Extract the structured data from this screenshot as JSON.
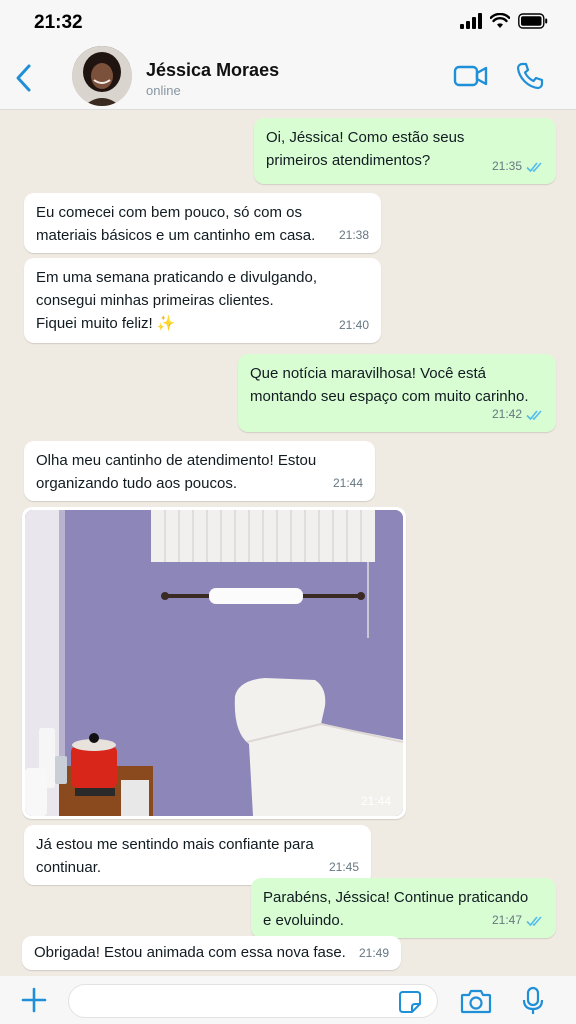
{
  "status_bar": {
    "time": "21:32"
  },
  "header": {
    "contact_name": "Jéssica Moraes",
    "contact_status": "online"
  },
  "colors": {
    "accent": "#1f8fd8",
    "outgoing_bubble": "#d9fdd3",
    "incoming_bubble": "#ffffff",
    "chat_background": "#efeae2",
    "read_ticks": "#53bdeb"
  },
  "icons": {
    "back": "chevron-left-icon",
    "video": "video-camera-icon",
    "call": "phone-icon",
    "plus": "plus-icon",
    "sticker": "sticker-icon",
    "camera": "camera-icon",
    "mic": "microphone-icon"
  },
  "messages": [
    {
      "direction": "out",
      "text": "Oi, Jéssica! Como estão seus\nprimeiros atendimentos?",
      "time": "21:35",
      "read": true
    },
    {
      "direction": "in",
      "text": "Eu comecei com bem pouco, só com os\nmateriais básicos e um cantinho em casa.",
      "time": "21:38"
    },
    {
      "direction": "in",
      "text": "Em uma semana praticando e divulgando,\nconsegui minhas primeiras clientes.\nFiquei muito feliz! ✨",
      "time": "21:40"
    },
    {
      "direction": "out",
      "text": "Que notícia maravilhosa! Você está\nmontando seu espaço com muito carinho.",
      "time": "21:42",
      "read": true
    },
    {
      "direction": "in",
      "text": "Olha meu cantinho de atendimento! Estou\norganizando tudo aos poucos.",
      "time": "21:44"
    },
    {
      "direction": "in",
      "type": "image",
      "time": "21:44"
    },
    {
      "direction": "in",
      "text": "Já estou me sentindo mais confiante para\ncontinuar.",
      "time": "21:45"
    },
    {
      "direction": "out",
      "text": "Parabéns, Jéssica! Continue praticando\ne evoluindo.",
      "time": "21:47",
      "read": true
    },
    {
      "direction": "in",
      "text": "Obrigada! Estou animada com essa nova fase.",
      "time": "21:49"
    }
  ],
  "input": {
    "value": "",
    "placeholder": ""
  }
}
